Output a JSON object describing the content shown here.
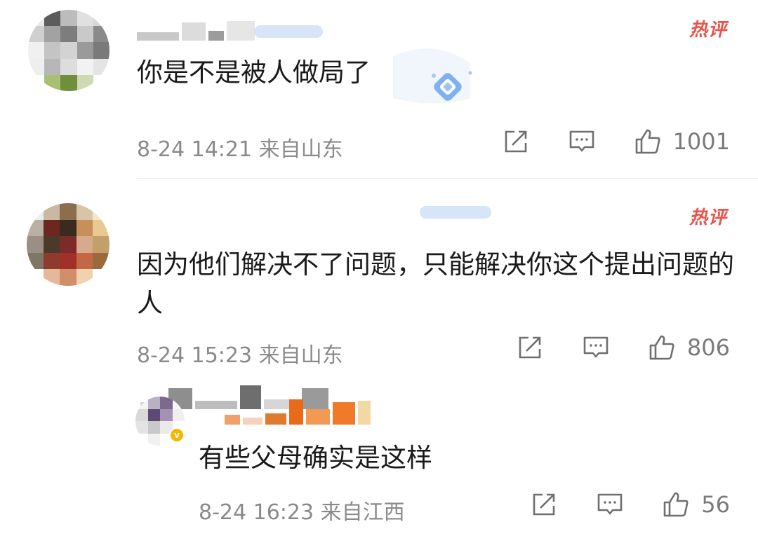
{
  "comments": [
    {
      "hot_label": "热评",
      "text": "你是不是被人做局了",
      "time": "8-24 14:21",
      "location": "来自山东",
      "likes": "1001"
    },
    {
      "hot_label": "热评",
      "text": "因为他们解决不了问题，只能解决你这个提出问题的人",
      "time": "8-24 15:23",
      "location": "来自山东",
      "likes": "806"
    },
    {
      "hot_label": "",
      "text": "有些父母确实是这样",
      "time": "8-24 16:23",
      "location": "来自江西",
      "likes": "56"
    }
  ],
  "icons": {
    "share": "share-icon",
    "reply": "comment-icon",
    "like": "thumbs-up-icon",
    "verified": "verified-badge-icon"
  },
  "colors": {
    "hot": "#e8534a",
    "meta": "#8a8a8a",
    "text": "#1a1a1a"
  }
}
